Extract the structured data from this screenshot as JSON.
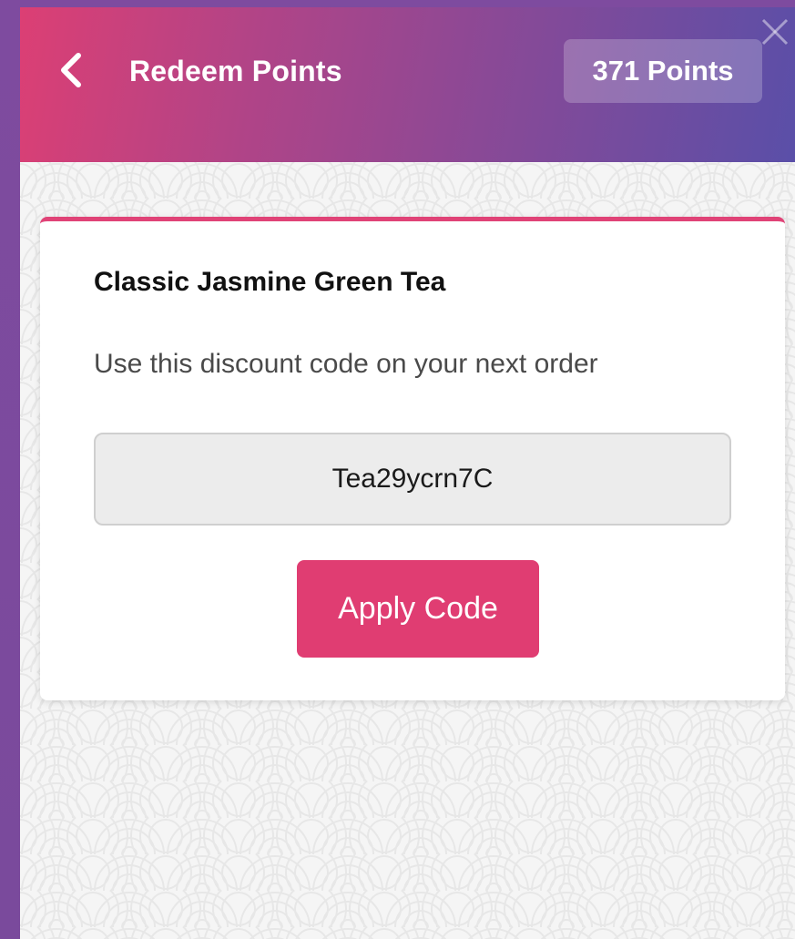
{
  "header": {
    "title": "Redeem Points",
    "points_badge": "371 Points",
    "back_icon": "chevron-left-icon",
    "close_icon": "close-icon"
  },
  "reward": {
    "title": "Classic Jasmine Green Tea",
    "description": "Use this discount code on your next order",
    "code": "Tea29ycrn7C",
    "apply_label": "Apply Code"
  },
  "colors": {
    "accent": "#e03d72",
    "header_start": "#dc3f74",
    "header_end": "#5a4fa8",
    "frame": "#7e4b9f"
  }
}
